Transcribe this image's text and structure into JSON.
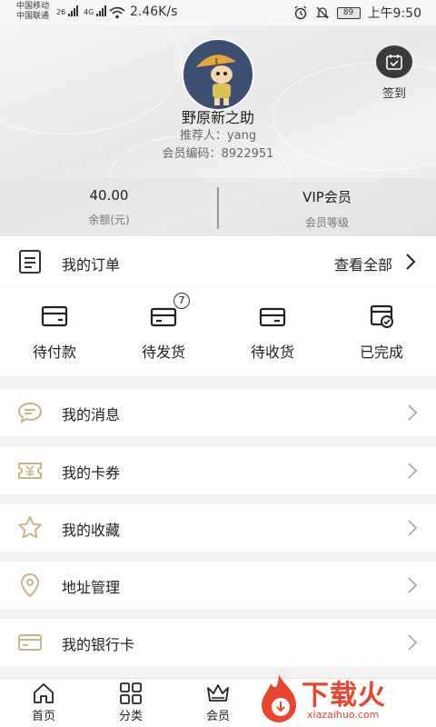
{
  "status_bar": {
    "carrier_1": "中国移动",
    "carrier_2": "中国联通",
    "sig_1_tag": "26",
    "sig_2_tag": "4G",
    "net_speed": "2.46K/s",
    "battery": "89",
    "time": "上午9:50"
  },
  "profile": {
    "username": "野原新之助",
    "referrer": "推荐人：yang",
    "member_no": "会员编码：8922951",
    "checkin_label": "签到"
  },
  "stats": {
    "balance_value": "40.00",
    "balance_label": "余额(元)",
    "level_value": "VIP会员",
    "level_label": "会员等级"
  },
  "orders": {
    "title": "我的订单",
    "view_all": "查看全部",
    "items": [
      {
        "label": "待付款"
      },
      {
        "label": "待发货",
        "badge": "7"
      },
      {
        "label": "待收货"
      },
      {
        "label": "已完成"
      }
    ]
  },
  "menu": [
    {
      "label": "我的消息",
      "icon": "message-icon"
    },
    {
      "label": "我的卡券",
      "icon": "coupon-icon"
    },
    {
      "label": "我的收藏",
      "icon": "star-icon"
    },
    {
      "label": "地址管理",
      "icon": "location-icon"
    },
    {
      "label": "我的银行卡",
      "icon": "bank-card-icon"
    }
  ],
  "nav": [
    {
      "label": "首页",
      "icon": "home-icon"
    },
    {
      "label": "分类",
      "icon": "grid-icon"
    },
    {
      "label": "会员",
      "icon": "crown-icon"
    }
  ],
  "watermark": {
    "text": "下载火",
    "url": "xiazaihuo.com"
  },
  "colors": {
    "accent_icon": "#c9b48a",
    "watermark": "#e8452c"
  }
}
